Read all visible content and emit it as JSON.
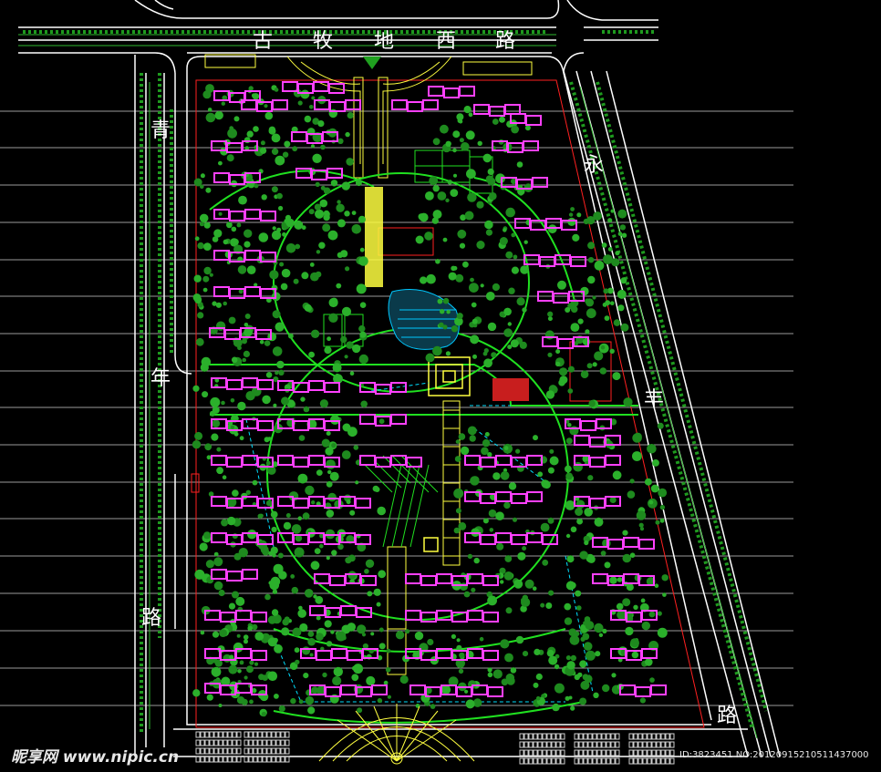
{
  "roads": {
    "top": [
      "古",
      "牧",
      "地",
      "西",
      "路"
    ],
    "left": [
      "青",
      "年",
      "路"
    ],
    "right": [
      "永",
      "丰",
      "路"
    ]
  },
  "watermark": {
    "site": "昵享网 www.nipic.cn",
    "id": "ID:3823451 NO:20120915210511437000"
  },
  "colors": {
    "background": "#000000",
    "road": "#ffffff",
    "trees": "#1e8a1e",
    "buildings": "#ff00ff",
    "paths": "#20e020",
    "plaza": "#ffff40",
    "water": "#00c8ff",
    "boundary": "#ff2020",
    "grid": "#9a9a9a"
  }
}
